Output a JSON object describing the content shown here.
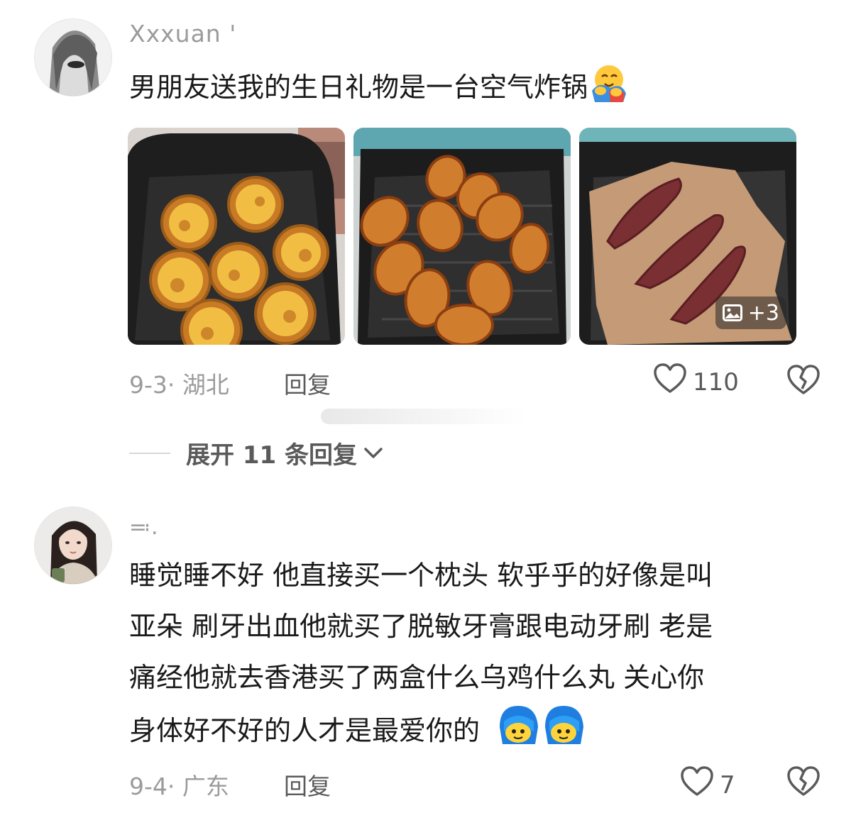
{
  "comments": [
    {
      "username": "Xxxuan '",
      "text": "男朋友送我的生日礼物是一台空气炸锅",
      "photos": [
        {
          "subject": "egg-tarts-air-fryer"
        },
        {
          "subject": "chicken-wings-air-fryer"
        },
        {
          "subject": "sweet-potatoes-air-fryer"
        }
      ],
      "more_photos": "+3",
      "date_location": "9-3· 湖北",
      "reply_label": "回复",
      "likes": "110",
      "expand_label": "展开 11 条回复"
    },
    {
      "username": "≕.",
      "text_lines": [
        "睡觉睡不好 他直接买一个枕头 软乎乎的好像是叫",
        "亚朵 刷牙出血他就买了脱敏牙膏跟电动牙刷 老是",
        "痛经他就去香港买了两盒什么乌鸡什么丸 关心你",
        "身体好不好的人才是最爱你的"
      ],
      "date_location": "9-4· 广东",
      "reply_label": "回复",
      "likes": "7"
    }
  ],
  "icons": {
    "like": "heart-outline-icon",
    "dislike": "broken-heart-icon",
    "expand": "chevron-down-icon",
    "gallery": "image-icon",
    "hug_emoji": "hugging-face-emoji",
    "blush_emoji": "blue-hair-face-emoji"
  },
  "colors": {
    "text": "#1a1a1a",
    "meta": "#9b9b9b",
    "action": "#5a5a5a"
  }
}
